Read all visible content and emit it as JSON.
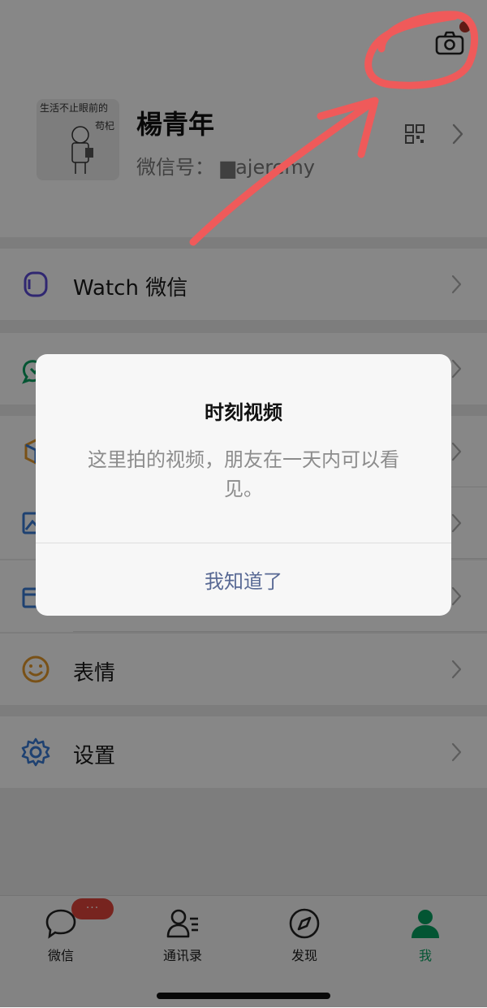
{
  "profile": {
    "name": "楊青年",
    "wechat_id_label": "微信号：",
    "wechat_id_value": "    ▆ajeremy",
    "avatar_text_line1": "生活不止眼前的",
    "avatar_text_line2": "苟杞"
  },
  "menu": [
    {
      "label": "Watch 微信",
      "icon": "watch-icon"
    },
    {
      "label": "",
      "icon": "pay-icon"
    },
    {
      "label": "",
      "icon": "favorites-icon"
    },
    {
      "label": "",
      "icon": "album-icon"
    },
    {
      "label": "",
      "icon": "cards-icon"
    },
    {
      "label": "表情",
      "icon": "sticker-icon"
    },
    {
      "label": "设置",
      "icon": "settings-gear-icon"
    }
  ],
  "tabbar": {
    "tabs": [
      {
        "label": "微信",
        "icon": "chat-bubble-icon"
      },
      {
        "label": "通讯录",
        "icon": "contacts-icon"
      },
      {
        "label": "发现",
        "icon": "compass-icon"
      },
      {
        "label": "我",
        "icon": "person-icon"
      }
    ],
    "badge": "···",
    "active_color": "#07a160"
  },
  "dialog": {
    "title": "时刻视频",
    "message": "这里拍的视频，朋友在一天内可以看见。",
    "button": "我知道了"
  },
  "colors": {
    "annotation": "#ef5a5a",
    "badge": "#b5342a",
    "link": "#586994"
  }
}
